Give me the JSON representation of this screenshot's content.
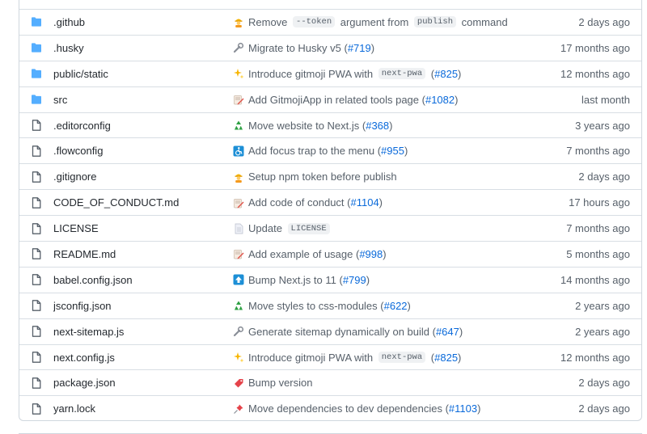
{
  "colors": {
    "folder": "#54aeff",
    "file_icon": "#57606a",
    "link": "#0969da",
    "muted": "#57606a",
    "border": "#d0d7de"
  },
  "rows": [
    {
      "kind": "folder",
      "name": ".github",
      "emoji": "construction-worker-icon",
      "msg": [
        {
          "t": "text",
          "v": "Remove "
        },
        {
          "t": "code",
          "v": "--token"
        },
        {
          "t": "text",
          "v": " argument from "
        },
        {
          "t": "code",
          "v": "publish"
        },
        {
          "t": "text",
          "v": " command"
        }
      ],
      "date": "2 days ago"
    },
    {
      "kind": "folder",
      "name": ".husky",
      "emoji": "wrench-icon",
      "msg": [
        {
          "t": "text",
          "v": "Migrate to Husky v5 ("
        },
        {
          "t": "link",
          "v": "#719"
        },
        {
          "t": "text",
          "v": ")"
        }
      ],
      "date": "17 months ago"
    },
    {
      "kind": "folder",
      "name": "public/static",
      "emoji": "sparkles-icon",
      "msg": [
        {
          "t": "text",
          "v": "Introduce gitmoji PWA with "
        },
        {
          "t": "code",
          "v": "next-pwa"
        },
        {
          "t": "text",
          "v": " ("
        },
        {
          "t": "link",
          "v": "#825"
        },
        {
          "t": "text",
          "v": ")"
        }
      ],
      "date": "12 months ago"
    },
    {
      "kind": "folder",
      "name": "src",
      "emoji": "memo-icon",
      "msg": [
        {
          "t": "text",
          "v": "Add GitmojiApp in related tools page ("
        },
        {
          "t": "link",
          "v": "#1082"
        },
        {
          "t": "text",
          "v": ")"
        }
      ],
      "date": "last month"
    },
    {
      "kind": "file",
      "name": ".editorconfig",
      "emoji": "recycle-icon",
      "msg": [
        {
          "t": "text",
          "v": "Move website to Next.js ("
        },
        {
          "t": "link",
          "v": "#368"
        },
        {
          "t": "text",
          "v": ")"
        }
      ],
      "date": "3 years ago"
    },
    {
      "kind": "file",
      "name": ".flowconfig",
      "emoji": "wheelchair-icon",
      "msg": [
        {
          "t": "text",
          "v": "Add focus trap to the menu ("
        },
        {
          "t": "link",
          "v": "#955"
        },
        {
          "t": "text",
          "v": ")"
        }
      ],
      "date": "7 months ago"
    },
    {
      "kind": "file",
      "name": ".gitignore",
      "emoji": "construction-worker-icon",
      "msg": [
        {
          "t": "text",
          "v": "Setup npm token before publish"
        }
      ],
      "date": "2 days ago"
    },
    {
      "kind": "file",
      "name": "CODE_OF_CONDUCT.md",
      "emoji": "memo-icon",
      "msg": [
        {
          "t": "text",
          "v": "Add code of conduct ("
        },
        {
          "t": "link",
          "v": "#1104"
        },
        {
          "t": "text",
          "v": ")"
        }
      ],
      "date": "17 hours ago"
    },
    {
      "kind": "file",
      "name": "LICENSE",
      "emoji": "page-icon",
      "msg": [
        {
          "t": "text",
          "v": "Update "
        },
        {
          "t": "code",
          "v": "LICENSE"
        }
      ],
      "date": "7 months ago"
    },
    {
      "kind": "file",
      "name": "README.md",
      "emoji": "memo-icon",
      "msg": [
        {
          "t": "text",
          "v": "Add example of usage ("
        },
        {
          "t": "link",
          "v": "#998"
        },
        {
          "t": "text",
          "v": ")"
        }
      ],
      "date": "5 months ago"
    },
    {
      "kind": "file",
      "name": "babel.config.json",
      "emoji": "arrow-up-icon",
      "msg": [
        {
          "t": "text",
          "v": "Bump Next.js to 11 ("
        },
        {
          "t": "link",
          "v": "#799"
        },
        {
          "t": "text",
          "v": ")"
        }
      ],
      "date": "14 months ago"
    },
    {
      "kind": "file",
      "name": "jsconfig.json",
      "emoji": "recycle-icon",
      "msg": [
        {
          "t": "text",
          "v": "Move styles to css-modules ("
        },
        {
          "t": "link",
          "v": "#622"
        },
        {
          "t": "text",
          "v": ")"
        }
      ],
      "date": "2 years ago"
    },
    {
      "kind": "file",
      "name": "next-sitemap.js",
      "emoji": "wrench-icon",
      "msg": [
        {
          "t": "text",
          "v": "Generate sitemap dynamically on build ("
        },
        {
          "t": "link",
          "v": "#647"
        },
        {
          "t": "text",
          "v": ")"
        }
      ],
      "date": "2 years ago"
    },
    {
      "kind": "file",
      "name": "next.config.js",
      "emoji": "sparkles-icon",
      "msg": [
        {
          "t": "text",
          "v": "Introduce gitmoji PWA with "
        },
        {
          "t": "code",
          "v": "next-pwa"
        },
        {
          "t": "text",
          "v": " ("
        },
        {
          "t": "link",
          "v": "#825"
        },
        {
          "t": "text",
          "v": ")"
        }
      ],
      "date": "12 months ago"
    },
    {
      "kind": "file",
      "name": "package.json",
      "emoji": "bookmark-icon",
      "msg": [
        {
          "t": "text",
          "v": "Bump version"
        }
      ],
      "date": "2 days ago"
    },
    {
      "kind": "file",
      "name": "yarn.lock",
      "emoji": "pushpin-icon",
      "msg": [
        {
          "t": "text",
          "v": "Move dependencies to dev dependencies ("
        },
        {
          "t": "link",
          "v": "#1103"
        },
        {
          "t": "text",
          "v": ")"
        }
      ],
      "date": "2 days ago"
    }
  ]
}
